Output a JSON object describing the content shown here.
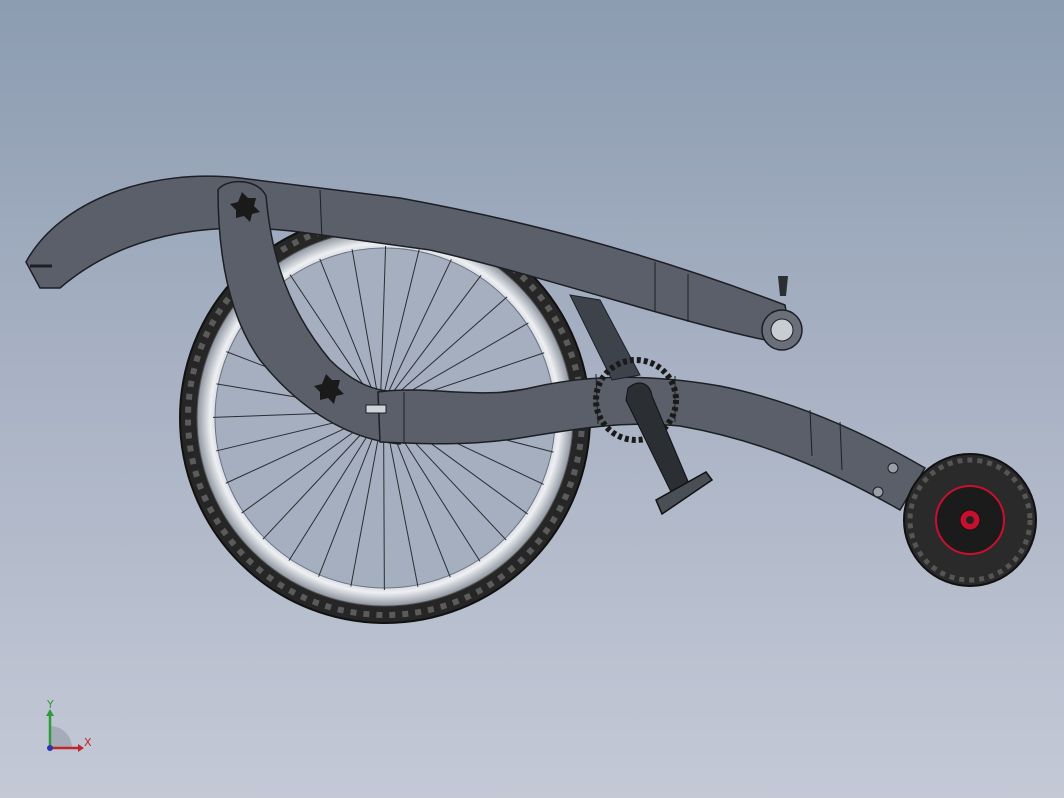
{
  "viewport": {
    "background_top": "#8c9cb1",
    "background_bottom": "#c4c9d6"
  },
  "model": {
    "frame_color": "#5a5f69",
    "frame_edge": "#1c1f24",
    "tire_color": "#2a2a2a",
    "rim_color": "#d9dde3",
    "hub_accent": "#c8102e"
  },
  "triad": {
    "x_label": "X",
    "y_label": "Y",
    "x_color": "#c0262b",
    "y_color": "#2e9a3a",
    "z_color": "#2837b0"
  }
}
